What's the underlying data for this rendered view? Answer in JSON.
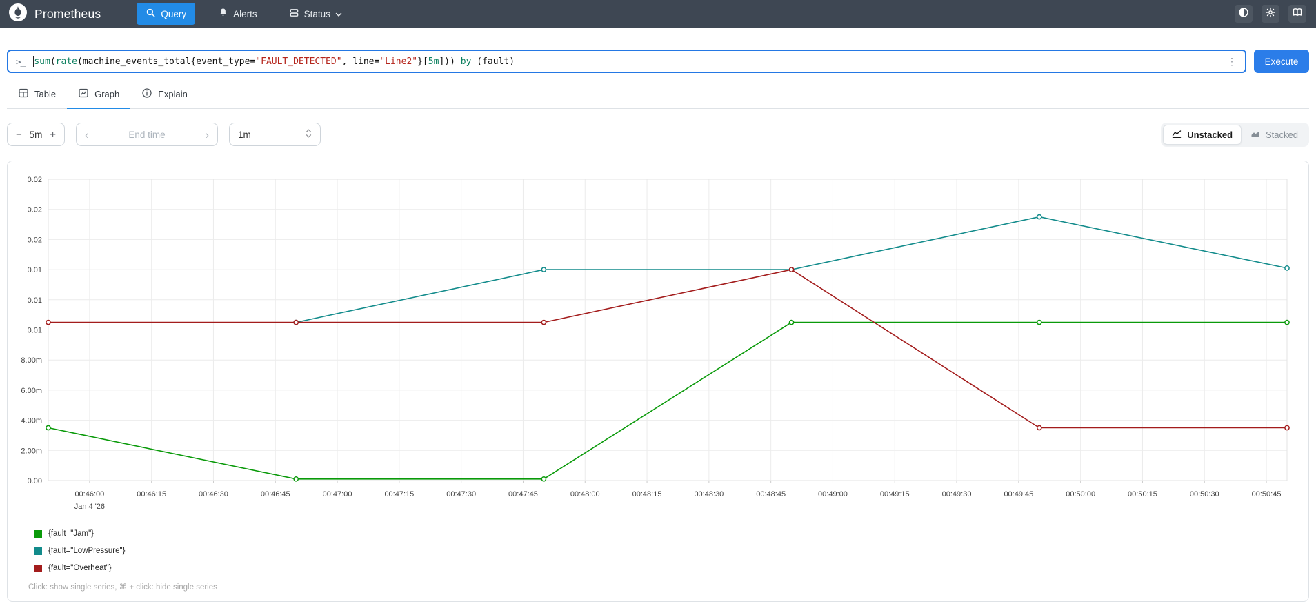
{
  "navbar": {
    "brand": "Prometheus",
    "items": [
      {
        "label": "Query",
        "active": true
      },
      {
        "label": "Alerts",
        "active": false
      },
      {
        "label": "Status",
        "active": false,
        "has_dropdown": true
      }
    ],
    "right_icons": [
      "theme-contrast-icon",
      "settings-gear-icon",
      "documentation-book-icon"
    ]
  },
  "colors": {
    "navbar_bg": "#3e4753",
    "accent_blue": "#228be6",
    "execute_blue": "#2b7de9",
    "input_focus_border": "#2478e4"
  },
  "icons": {
    "terminal_prompt": ">_",
    "kebab": "⋮",
    "minus": "−",
    "plus": "+",
    "chevron_left": "‹",
    "chevron_right": "›"
  },
  "query": {
    "value": "sum(rate(machine_events_total{event_type=\"FAULT_DETECTED\", line=\"Line2\"}[5m])) by (fault)",
    "execute_label": "Execute",
    "token_colors": {
      "fn": "#0e8160",
      "kw": "#0e8160",
      "dur": "#0e8160",
      "str": "#b5261d",
      "p": "#111111",
      "metric": "#111111",
      "label": "#111111"
    },
    "tokens": [
      {
        "text": "sum",
        "type": "fn"
      },
      {
        "text": "(",
        "type": "p"
      },
      {
        "text": "rate",
        "type": "fn"
      },
      {
        "text": "(",
        "type": "p"
      },
      {
        "text": "machine_events_total",
        "type": "metric"
      },
      {
        "text": "{",
        "type": "p"
      },
      {
        "text": "event_type",
        "type": "label"
      },
      {
        "text": "=",
        "type": "p"
      },
      {
        "text": "\"FAULT_DETECTED\"",
        "type": "str"
      },
      {
        "text": ", ",
        "type": "p"
      },
      {
        "text": "line",
        "type": "label"
      },
      {
        "text": "=",
        "type": "p"
      },
      {
        "text": "\"Line2\"",
        "type": "str"
      },
      {
        "text": "}",
        "type": "p"
      },
      {
        "text": "[",
        "type": "p"
      },
      {
        "text": "5m",
        "type": "dur"
      },
      {
        "text": "]",
        "type": "p"
      },
      {
        "text": "))",
        "type": "p"
      },
      {
        "text": " ",
        "type": "p"
      },
      {
        "text": "by",
        "type": "kw"
      },
      {
        "text": " (",
        "type": "p"
      },
      {
        "text": "fault",
        "type": "label"
      },
      {
        "text": ")",
        "type": "p"
      }
    ]
  },
  "tabs": [
    {
      "label": "Table",
      "active": false
    },
    {
      "label": "Graph",
      "active": true
    },
    {
      "label": "Explain",
      "active": false
    }
  ],
  "controls": {
    "range_value": "5m",
    "end_time_placeholder": "End time",
    "resolution_value": "1m",
    "unstacked_label": "Unstacked",
    "stacked_label": "Stacked"
  },
  "chart_data": {
    "type": "line",
    "title": "",
    "xlabel": "",
    "ylabel": "",
    "grid": true,
    "legend_position": "bottom-left",
    "ylim": [
      0,
      0.02
    ],
    "x_domain": [
      "00:45:50",
      "00:50:50"
    ],
    "x_date_label": "Jan 4 '26",
    "x_labels": [
      "00:46:00",
      "00:46:15",
      "00:46:30",
      "00:46:45",
      "00:47:00",
      "00:47:15",
      "00:47:30",
      "00:47:45",
      "00:48:00",
      "00:48:15",
      "00:48:30",
      "00:48:45",
      "00:49:00",
      "00:49:15",
      "00:49:30",
      "00:49:45",
      "00:50:00",
      "00:50:15",
      "00:50:30",
      "00:50:45"
    ],
    "yticks": [
      {
        "value": 0.02,
        "label": "0.02"
      },
      {
        "value": 0.018,
        "label": "0.02"
      },
      {
        "value": 0.016,
        "label": "0.02"
      },
      {
        "value": 0.014,
        "label": "0.01"
      },
      {
        "value": 0.012,
        "label": "0.01"
      },
      {
        "value": 0.01,
        "label": "0.01"
      },
      {
        "value": 0.008,
        "label": "8.00m"
      },
      {
        "value": 0.006,
        "label": "6.00m"
      },
      {
        "value": 0.004,
        "label": "4.00m"
      },
      {
        "value": 0.002,
        "label": "2.00m"
      },
      {
        "value": 0.0,
        "label": "0.00"
      }
    ],
    "sample_times": [
      "00:45:50",
      "00:46:50",
      "00:47:50",
      "00:48:50",
      "00:49:50",
      "00:50:50"
    ],
    "series": [
      {
        "name": "{fault=\"Jam\"}",
        "color": "#0a9a0a",
        "values": [
          0.0035,
          0.0001,
          0.0001,
          0.0105,
          0.0105,
          0.0105
        ]
      },
      {
        "name": "{fault=\"LowPressure\"}",
        "color": "#128b8b",
        "values": [
          null,
          0.0105,
          0.014,
          0.014,
          0.0175,
          0.0141
        ]
      },
      {
        "name": "{fault=\"Overheat\"}",
        "color": "#a31c1c",
        "values": [
          0.0105,
          0.0105,
          0.0105,
          0.014,
          0.0035,
          0.0035
        ]
      }
    ]
  },
  "footer_note": "Click: show single series, ⌘ + click: hide single series"
}
